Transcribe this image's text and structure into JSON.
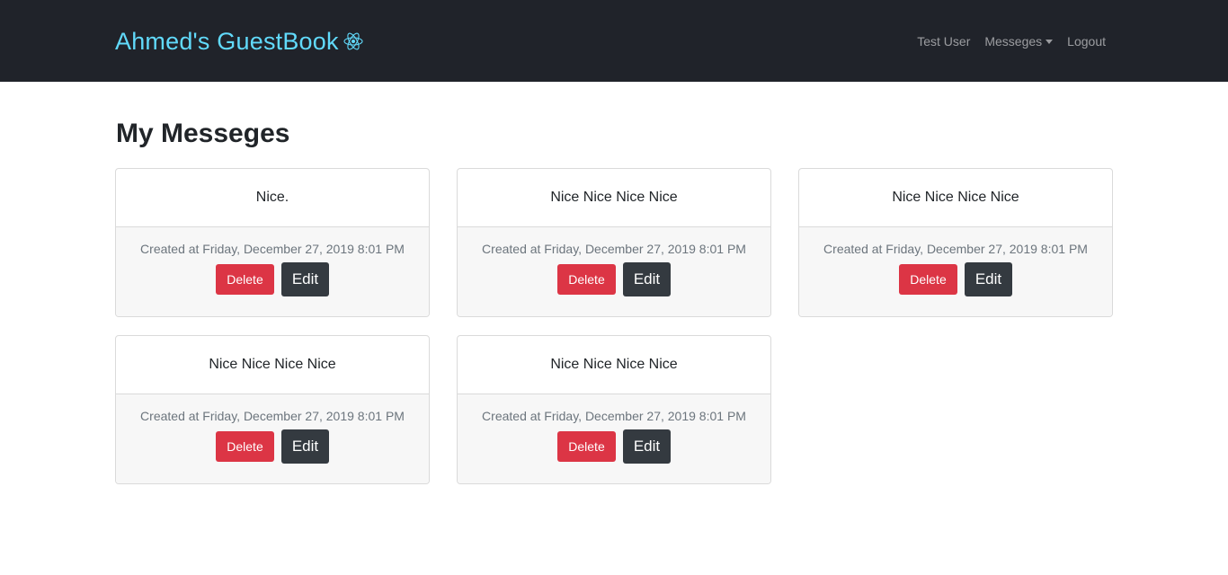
{
  "navbar": {
    "brand": "Ahmed's GuestBook",
    "brand_icon": "react-atom-icon",
    "brand_color": "#61dafb",
    "user_link": "Test User",
    "messages_dropdown": "Messeges",
    "logout_link": "Logout"
  },
  "page": {
    "title": "My Messeges"
  },
  "messages": [
    {
      "text": "Nice.",
      "created": "Created at Friday, December 27, 2019 8:01 PM",
      "delete_label": "Delete",
      "edit_label": "Edit"
    },
    {
      "text": "Nice Nice Nice Nice",
      "created": "Created at Friday, December 27, 2019 8:01 PM",
      "delete_label": "Delete",
      "edit_label": "Edit"
    },
    {
      "text": "Nice Nice Nice Nice",
      "created": "Created at Friday, December 27, 2019 8:01 PM",
      "delete_label": "Delete",
      "edit_label": "Edit"
    },
    {
      "text": "Nice Nice Nice Nice",
      "created": "Created at Friday, December 27, 2019 8:01 PM",
      "delete_label": "Delete",
      "edit_label": "Edit"
    },
    {
      "text": "Nice Nice Nice Nice",
      "created": "Created at Friday, December 27, 2019 8:01 PM",
      "delete_label": "Delete",
      "edit_label": "Edit"
    }
  ],
  "colors": {
    "navbar_bg": "#20232a",
    "delete_button": "#dc3545",
    "edit_button": "#343a40"
  }
}
